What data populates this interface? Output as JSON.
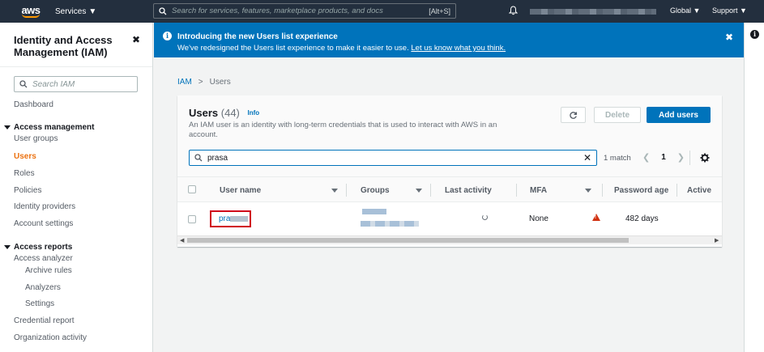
{
  "topnav": {
    "logo": "aws",
    "services": "Services",
    "search_placeholder": "Search for services, features, marketplace products, and docs",
    "search_shortcut": "[Alt+S]",
    "region": "Global",
    "support": "Support"
  },
  "sidebar": {
    "title": "Identity and Access Management (IAM)",
    "search_placeholder": "Search IAM",
    "dashboard": "Dashboard",
    "access_management": "Access management",
    "user_groups": "User groups",
    "users": "Users",
    "roles": "Roles",
    "policies": "Policies",
    "identity_providers": "Identity providers",
    "account_settings": "Account settings",
    "access_reports": "Access reports",
    "access_analyzer": "Access analyzer",
    "archive_rules": "Archive rules",
    "analyzers": "Analyzers",
    "settings": "Settings",
    "credential_report": "Credential report",
    "organization_activity": "Organization activity"
  },
  "banner": {
    "title": "Introducing the new Users list experience",
    "text": "We've redesigned the Users list experience to make it easier to use.",
    "link": "Let us know what you think."
  },
  "breadcrumb": {
    "root": "IAM",
    "separator": ">",
    "current": "Users"
  },
  "users_panel": {
    "title": "Users",
    "count": "(44)",
    "info": "Info",
    "description": "An IAM user is an identity with long-term credentials that is used to interact with AWS in an account.",
    "delete_label": "Delete",
    "add_label": "Add users",
    "filter_value": "prasa",
    "match_text": "1 match",
    "page": "1",
    "columns": {
      "user_name": "User name",
      "groups": "Groups",
      "last_activity": "Last activity",
      "mfa": "MFA",
      "password_age": "Password age",
      "active": "Active"
    },
    "rows": [
      {
        "user_name": "pra",
        "mfa": "None",
        "password_age": "482 days"
      }
    ]
  }
}
